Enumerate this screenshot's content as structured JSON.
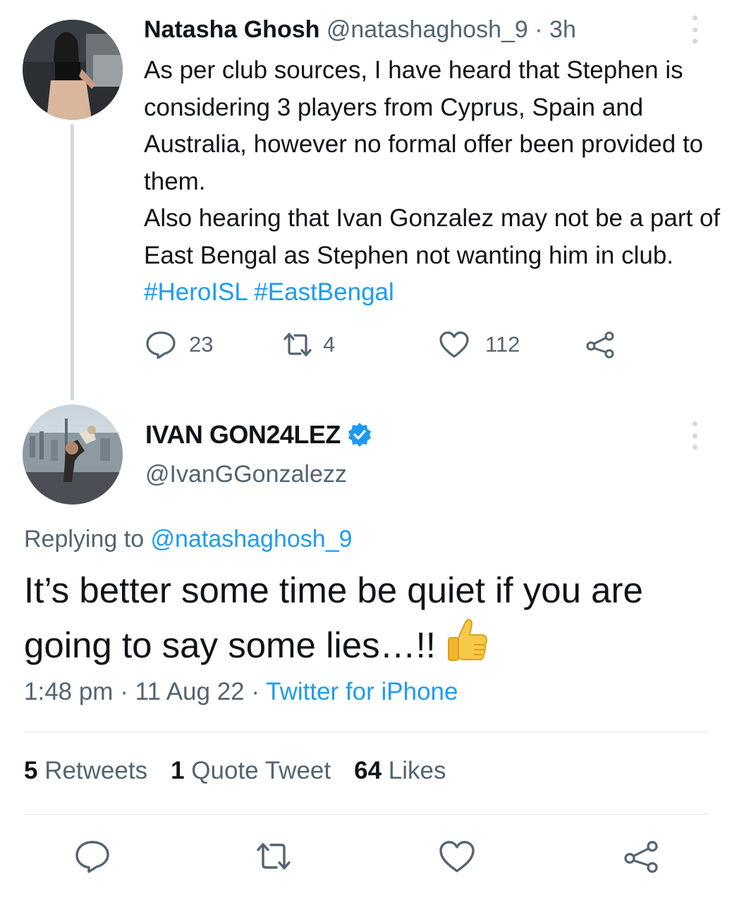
{
  "tweet1": {
    "name": "Natasha Ghosh",
    "handle": "@natashaghosh_9",
    "separator": " · ",
    "time": "3h",
    "body_lines": [
      "As per club sources, I have heard that Stephen is considering 3 players from Cyprus, Spain and Australia, however no formal offer been provided to them.",
      "Also hearing that Ivan Gonzalez may not be a part of East Bengal as Stephen not wanting him in club. "
    ],
    "hashtags": [
      "#HeroISL",
      "#EastBengal"
    ],
    "replies": "23",
    "retweets": "4",
    "likes": "112",
    "icons": [
      "reply-icon",
      "retweet-icon",
      "like-icon",
      "share-icon",
      "more-icon"
    ]
  },
  "tweet2": {
    "name": "IVAN GON24LEZ",
    "handle": "@IvanGGonzalezz",
    "verified_icon": "verified-badge-icon",
    "replying_prefix": "Replying to ",
    "replying_handle": "@natashaghosh_9",
    "body": "It’s better some time be quiet if you are going to say some lies…!! ",
    "emoji": "👍",
    "time": "1:48 pm",
    "sep1": " · ",
    "date": "11 Aug 22",
    "sep2": " · ",
    "source": "Twitter for iPhone",
    "stats": {
      "retweets_count": "5",
      "retweets_label": " Retweets",
      "quotes_count": "1",
      "quotes_label": " Quote Tweet",
      "likes_count": "64",
      "likes_label": " Likes"
    }
  },
  "colors": {
    "link": "#1d9bf0",
    "secondary_text": "#536471",
    "primary_text": "#0f1419",
    "thread_line": "#cfd9de",
    "emoji": "#f7c948"
  }
}
